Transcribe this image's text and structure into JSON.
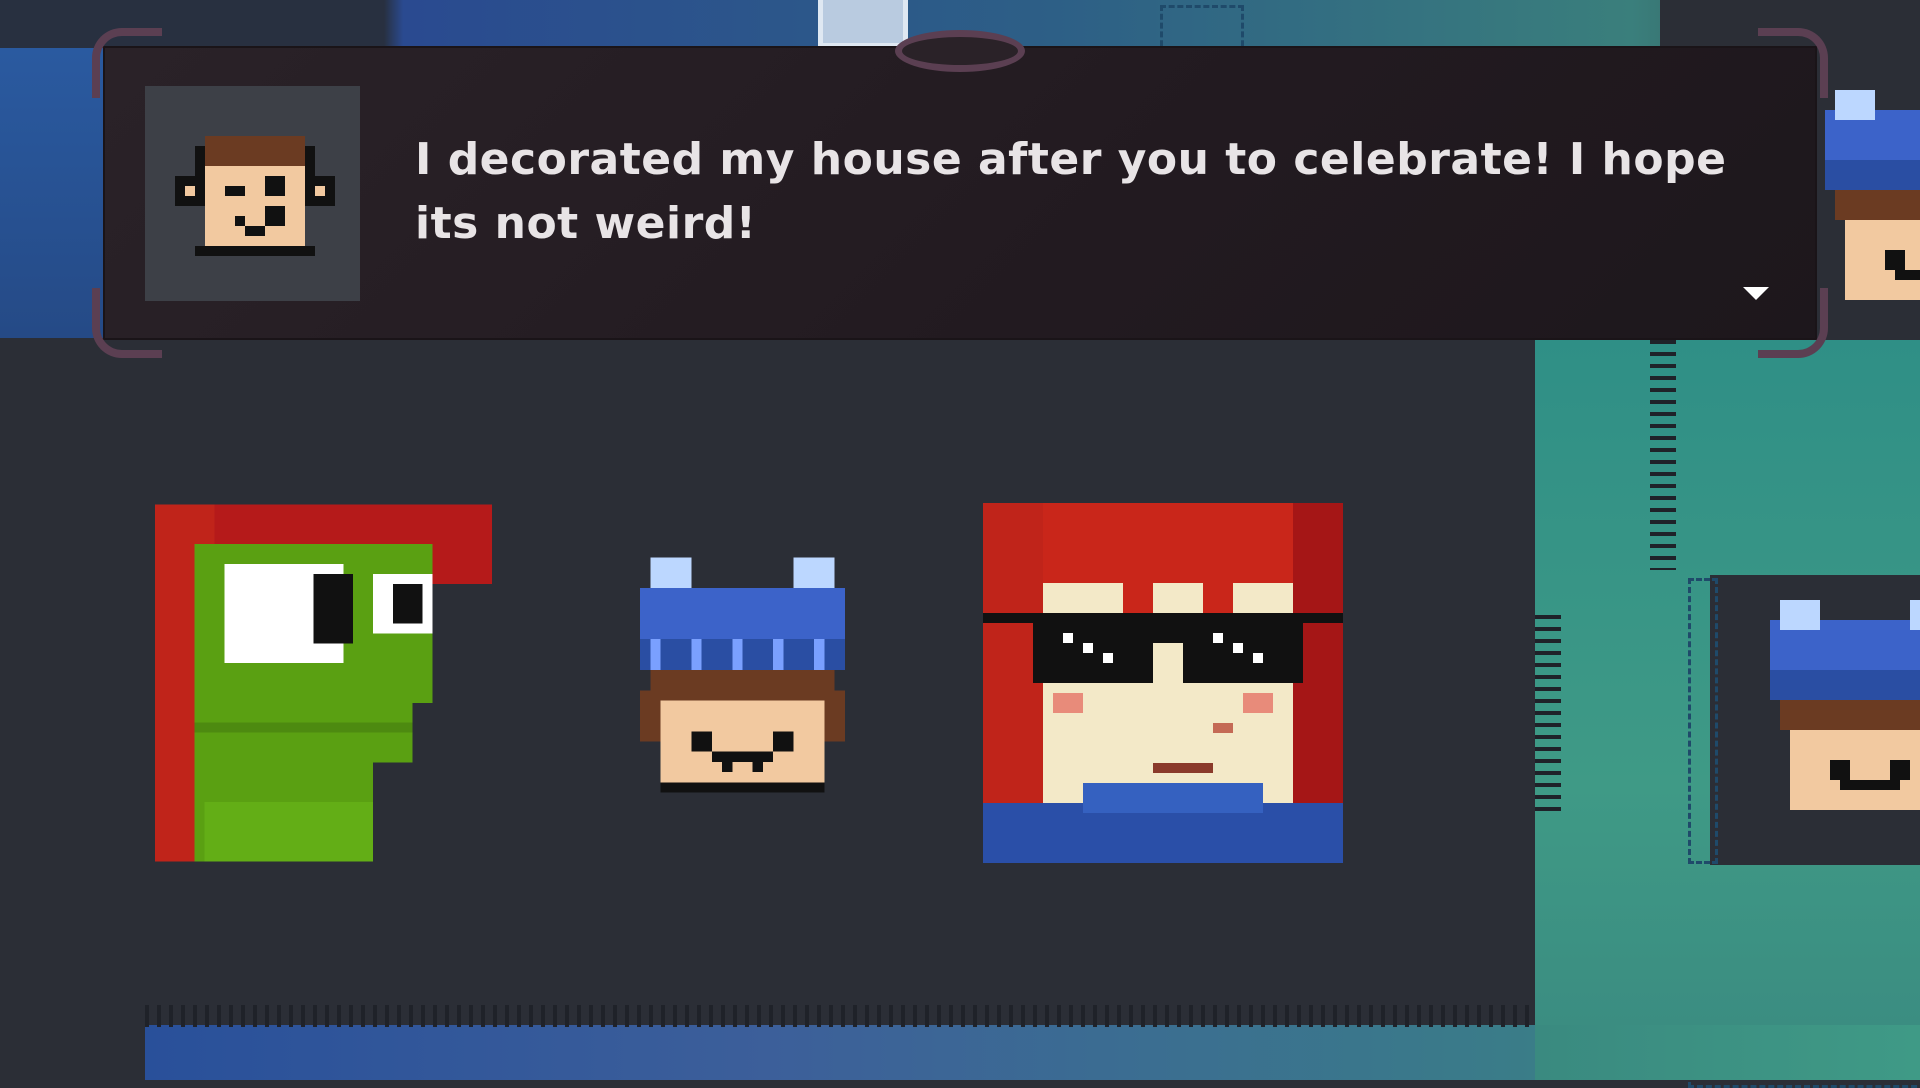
{
  "dialog": {
    "text": "I decorated my house after you to celebrate! I hope its not weird!",
    "speaker_portrait": "pixel-boy-face-icon",
    "advance_indicator": "triangle-down-icon"
  },
  "emotes": [
    {
      "name": "frog-madeline-emote"
    },
    {
      "name": "beanie-boy-emote"
    },
    {
      "name": "sunglasses-madeline-emote"
    }
  ],
  "colors": {
    "dialog_bg": "#221a20",
    "frame_ornament": "#5b3f52",
    "text": "#e8e4e6",
    "background": "#2b2e36",
    "teal": "#3f9a86",
    "blue": "#2a5aa0"
  }
}
